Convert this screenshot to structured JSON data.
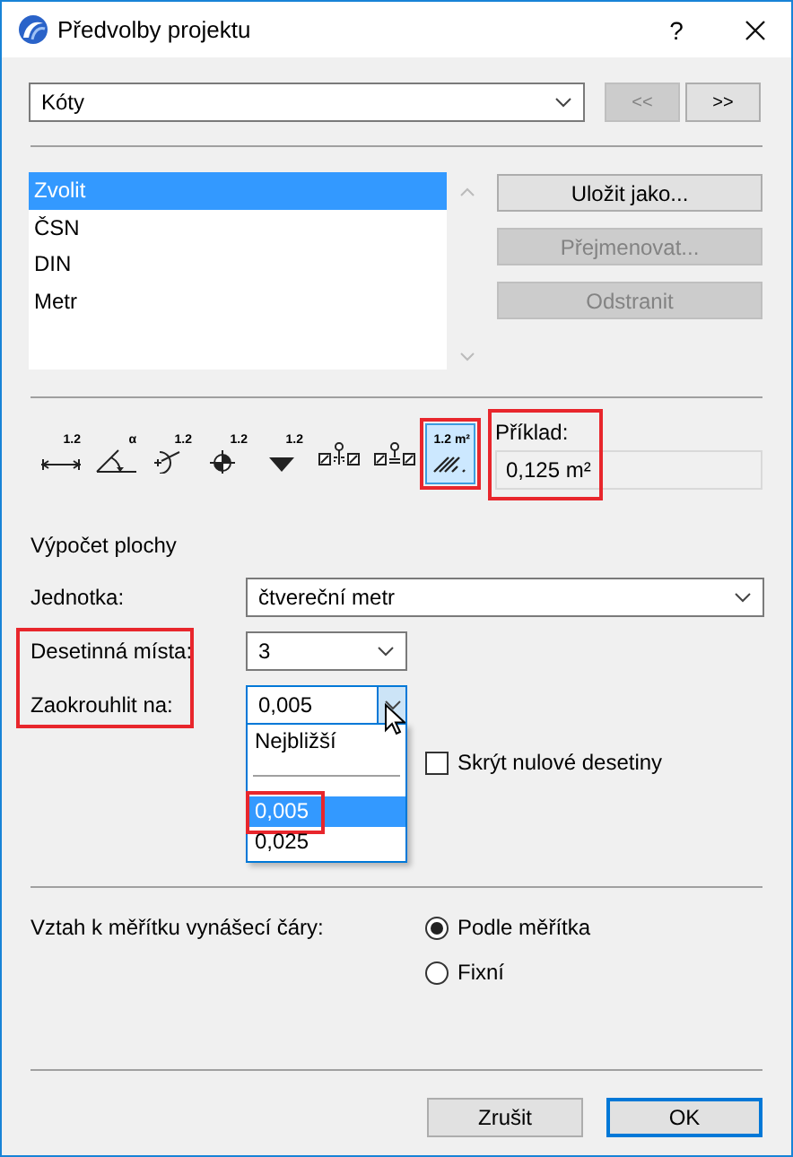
{
  "window": {
    "title": "Předvolby projektu",
    "help": "?"
  },
  "category": {
    "value": "Kóty"
  },
  "nav_buttons": [
    {
      "label": "<<",
      "disabled": true
    },
    {
      "label": ">>",
      "disabled": false
    }
  ],
  "presets": {
    "items": [
      {
        "label": "Zvolit",
        "selected": true
      },
      {
        "label": "ČSN",
        "selected": false
      },
      {
        "label": "DIN",
        "selected": false
      },
      {
        "label": "Metr",
        "selected": false
      }
    ]
  },
  "preset_buttons": [
    {
      "label": "Uložit jako...",
      "disabled": false
    },
    {
      "label": "Přejmenovat...",
      "disabled": true
    },
    {
      "label": "Odstranit",
      "disabled": true
    }
  ],
  "tools": [
    {
      "kind": "linear",
      "label": "1.2",
      "selected": false,
      "highlighted": false
    },
    {
      "kind": "angle",
      "label": "α",
      "selected": false,
      "highlighted": false
    },
    {
      "kind": "radius",
      "label": "1.2",
      "selected": false,
      "highlighted": false
    },
    {
      "kind": "level",
      "label": "1.2",
      "selected": false,
      "highlighted": false
    },
    {
      "kind": "elevation",
      "label": "1.2",
      "selected": false,
      "highlighted": false
    },
    {
      "kind": "door",
      "selected": false,
      "highlighted": false
    },
    {
      "kind": "sill",
      "selected": false,
      "highlighted": false
    },
    {
      "kind": "area",
      "label": "1.2 m²",
      "selected": true,
      "highlighted": true
    }
  ],
  "example": {
    "label": "Příklad:",
    "value": "0,125 m²",
    "highlighted": true
  },
  "area": {
    "heading": "Výpočet plochy",
    "fields": [
      {
        "label": "Jednotka:",
        "value": "čtvereční metr",
        "kind": "wide",
        "highlighted": false,
        "open": false
      },
      {
        "label": "Desetinná místa:",
        "value": "3",
        "kind": "narrow",
        "highlighted": true,
        "open": false
      },
      {
        "label": "Zaokrouhlit na:",
        "value": "0,005",
        "kind": "narrow",
        "highlighted": true,
        "open": true,
        "options": [
          {
            "kind": "option",
            "label": "Nejbližší",
            "selected": false,
            "highlighted": false
          },
          {
            "kind": "separator"
          },
          {
            "kind": "option",
            "label": "0,005",
            "selected": true,
            "highlighted": true
          },
          {
            "kind": "option",
            "label": "0,025",
            "selected": false,
            "highlighted": false
          }
        ]
      }
    ],
    "checkbox": {
      "label": "Skrýt nulové desetiny",
      "checked": false
    }
  },
  "scale": {
    "label": "Vztah k měřítku vynášecí čáry:",
    "options": [
      {
        "label": "Podle měřítka",
        "selected": true
      },
      {
        "label": "Fixní",
        "selected": false
      }
    ]
  },
  "footer_buttons": [
    {
      "label": "Zrušit",
      "default": false
    },
    {
      "label": "OK",
      "default": true
    }
  ]
}
